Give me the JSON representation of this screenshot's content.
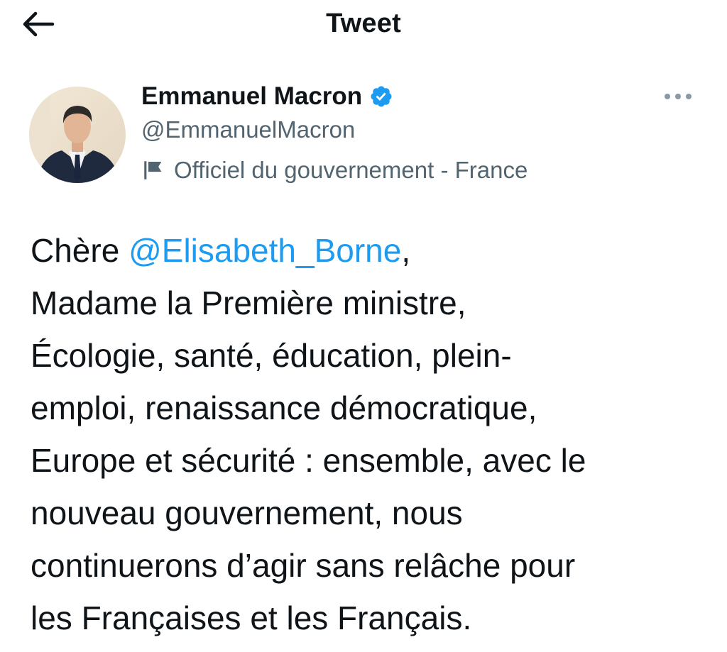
{
  "header": {
    "title": "Tweet",
    "back_icon": "arrow-left-icon"
  },
  "author": {
    "name": "Emmanuel Macron",
    "handle": "@EmmanuelMacron",
    "verified_icon": "verified-badge-icon",
    "label_icon": "flag-icon",
    "label": "Officiel du gouvernement - France"
  },
  "more_icon": "more-options-icon",
  "tweet": {
    "greeting_prefix": "Chère ",
    "mention": "@Elisabeth_Borne",
    "greeting_suffix": ",",
    "lines": [
      "Madame la Première ministre,",
      "Écologie, santé, éducation, plein-",
      "emploi, renaissance démocratique,",
      "Europe et sécurité : ensemble, avec le",
      "nouveau gouvernement, nous",
      "continuerons d’agir sans relâche pour",
      "les Françaises et les Français."
    ]
  },
  "colors": {
    "text": "#0f1419",
    "secondary": "#536471",
    "link": "#1d9bf0",
    "verified": "#1d9bf0",
    "background": "#ffffff"
  }
}
